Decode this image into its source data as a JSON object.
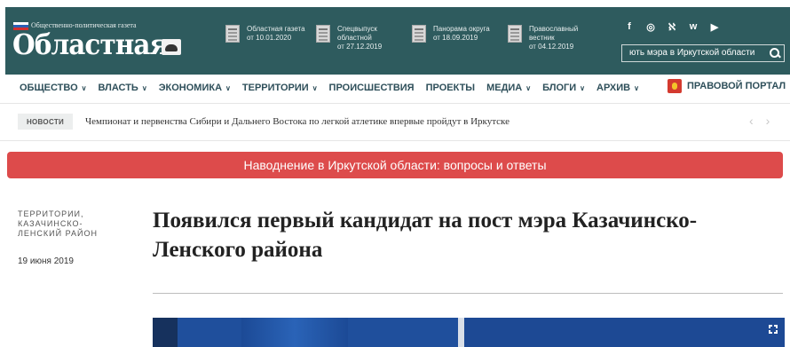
{
  "header": {
    "logo_small": "Общественно-политическая газета",
    "logo_big": "Областная",
    "flag_colors": [
      "#ffffff",
      "#2b5fb4",
      "#d32f2f"
    ],
    "publications": [
      {
        "line1": "Областная газета",
        "line2": "от 10.01.2020",
        "line3": ""
      },
      {
        "line1": "Спецвыпуск",
        "line2": "областной",
        "line3": "от 27.12.2019"
      },
      {
        "line1": "Панорама округа",
        "line2": "от 18.09.2019",
        "line3": ""
      },
      {
        "line1": "Православный",
        "line2": "вестник",
        "line3": "от 04.12.2019"
      }
    ],
    "social": [
      "f",
      "◎",
      "ℵ",
      "ᴡ",
      "▶"
    ],
    "search_value": "ють мэра в Иркутской области"
  },
  "nav": {
    "items": [
      {
        "label": "ОБЩЕСТВО",
        "chevron": "∨"
      },
      {
        "label": "ВЛАСТЬ",
        "chevron": "∨"
      },
      {
        "label": "ЭКОНОМИКА",
        "chevron": "∨"
      },
      {
        "label": "ТЕРРИТОРИИ",
        "chevron": "∨"
      },
      {
        "label": "ПРОИСШЕСТВИЯ",
        "chevron": ""
      },
      {
        "label": "ПРОЕКТЫ",
        "chevron": ""
      },
      {
        "label": "МЕДИА",
        "chevron": "∨"
      },
      {
        "label": "БЛОГИ",
        "chevron": "∨"
      },
      {
        "label": "АРХИВ",
        "chevron": "∨"
      }
    ],
    "legal_portal": "ПРАВОВОЙ ПОРТАЛ"
  },
  "ticker": {
    "badge": "НОВОСТИ",
    "text": "Чемпионат и первенства Сибири и Дальнего Востока по легкой атлетике впервые пройдут в Иркутске",
    "prev": "‹",
    "next": "›"
  },
  "banner": {
    "text": "Наводнение в Иркутской области: вопросы и ответы",
    "color": "#dd4b4b"
  },
  "article": {
    "category_lines": [
      "ТЕРРИТОРИИ,",
      "КАЗАЧИНСКО-",
      "ЛЕНСКИЙ РАЙОН"
    ],
    "date": "19 июня 2019",
    "title": "Появился первый кандидат на пост мэра Казачинско-Ленского района"
  },
  "colors": {
    "header_bg": "#2e5b5e",
    "nav_text": "#2e4f5a"
  }
}
